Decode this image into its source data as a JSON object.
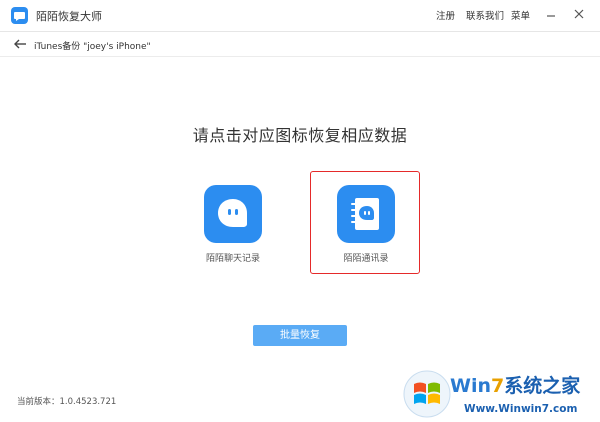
{
  "window": {
    "title": "陌陌恢复大师",
    "menu": [
      "注册",
      "联系我们",
      "菜单"
    ]
  },
  "breadcrumb": {
    "text": "iTunes备份  \"joey's iPhone\""
  },
  "main": {
    "headline": "请点击对应图标恢复相应数据",
    "options": [
      {
        "label": "陌陌聊天记录",
        "icon": "chat-bubble-icon",
        "selected": false
      },
      {
        "label": "陌陌通讯录",
        "icon": "contacts-book-icon",
        "selected": true
      }
    ],
    "batch_button": "批量恢复"
  },
  "footer": {
    "version": "当前版本：1.0.4523.721"
  },
  "watermark": {
    "brand_prefix": "Win",
    "brand_digit": "7",
    "brand_suffix": "系统之家",
    "url": "Www.Winwin7.com"
  },
  "colors": {
    "accent": "#2c8df0",
    "button": "#5aabf5",
    "highlight": "#e52a2a"
  }
}
